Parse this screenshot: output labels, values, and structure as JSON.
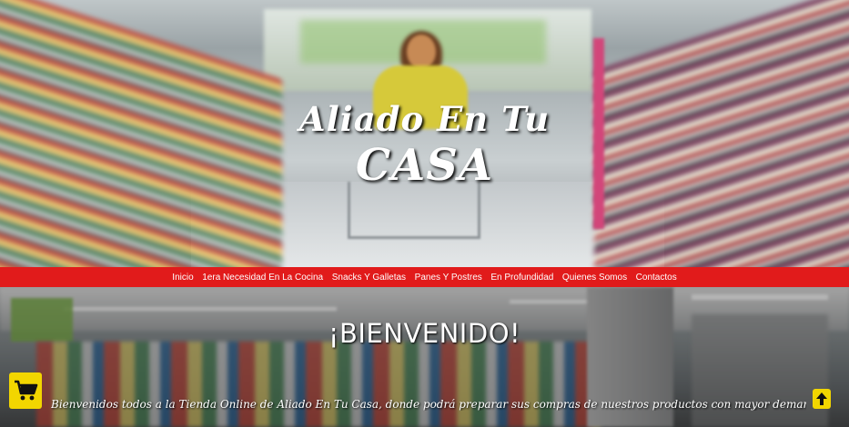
{
  "hero": {
    "title_line1": "Aliado En Tu",
    "title_line2": "CASA"
  },
  "nav": {
    "items": [
      {
        "label": "Inicio"
      },
      {
        "label": "1era Necesidad En La Cocina"
      },
      {
        "label": "Snacks Y Galletas"
      },
      {
        "label": "Panes Y Postres"
      },
      {
        "label": "En Profundidad"
      },
      {
        "label": "Quienes Somos"
      },
      {
        "label": "Contactos"
      }
    ]
  },
  "welcome": {
    "title": "¡BIENVENIDO!",
    "text": "Bienvenidos todos a la Tienda Online de Aliado En Tu Casa, donde podrá preparar sus compras de nuestros productos con mayor demanda desde la comodidad de su"
  },
  "colors": {
    "nav_bg": "#e11b1b",
    "button_bg": "#f2d600"
  },
  "icons": {
    "cart": "shopping-cart-icon",
    "up": "arrow-up-icon"
  }
}
